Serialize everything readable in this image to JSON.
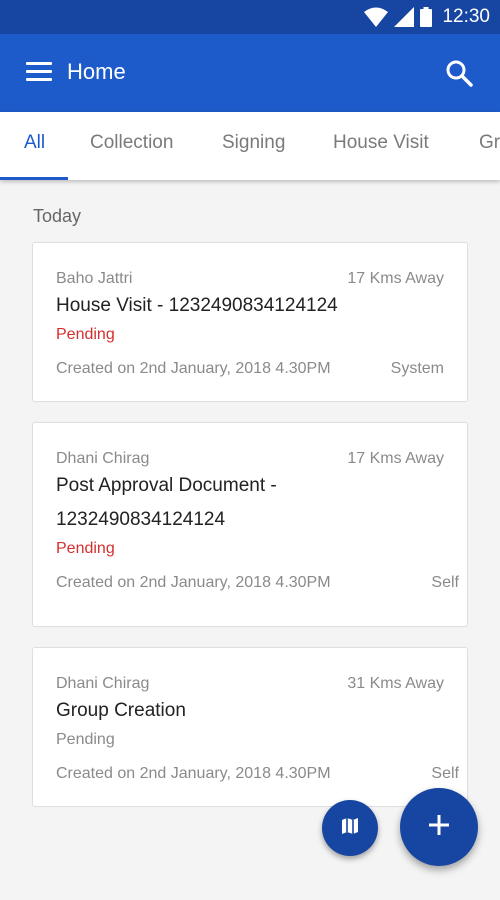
{
  "status_bar": {
    "time": "12:30"
  },
  "app_bar": {
    "title": "Home"
  },
  "tabs": [
    {
      "label": "All",
      "active": true
    },
    {
      "label": "Collection"
    },
    {
      "label": "Signing"
    },
    {
      "label": "House Visit"
    },
    {
      "label": "Gr"
    }
  ],
  "section": {
    "label": "Today"
  },
  "cards": [
    {
      "name": "Baho Jattri",
      "distance": "17 Kms Away",
      "title": "House Visit - 1232490834124124",
      "status": "Pending",
      "status_color": "#d32f2f",
      "created": "Created on 2nd January, 2018 4.30PM",
      "source": "System"
    },
    {
      "name": "Dhani Chirag",
      "distance": "17 Kms Away",
      "title": "Post Approval Document - 1232490834124124",
      "status": "Pending",
      "status_color": "#d32f2f",
      "created": "Created on 2nd January, 2018 4.30PM",
      "source": "Self"
    },
    {
      "name": "Dhani Chirag",
      "distance": "31 Kms Away",
      "title": "Group Creation",
      "status": "Pending",
      "status_color": "#8a8a8a",
      "created": "Created on 2nd January, 2018 4.30PM",
      "source": "Self"
    }
  ],
  "icons": {
    "menu": "menu-icon",
    "search": "search-icon",
    "map": "map-icon",
    "add": "plus-icon",
    "wifi": "wifi-icon",
    "signal": "signal-icon",
    "battery": "battery-icon"
  },
  "colors": {
    "primary": "#1c5bc9",
    "primary_dark": "#1746a2",
    "pending_red": "#d32f2f"
  }
}
